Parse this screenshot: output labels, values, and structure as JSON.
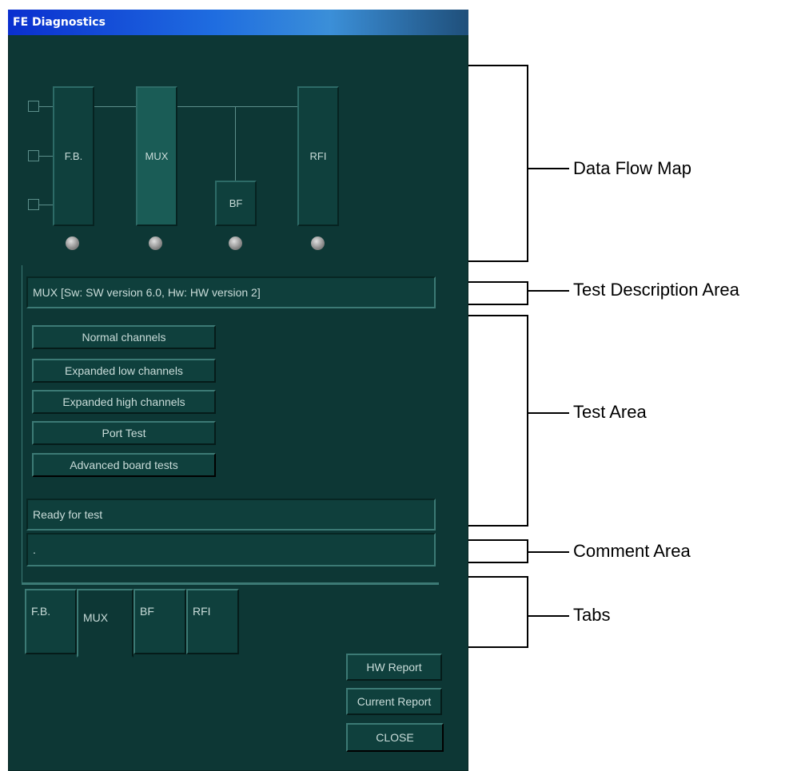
{
  "window": {
    "title": "FE Diagnostics"
  },
  "flow_map": {
    "blocks": [
      {
        "id": "fb",
        "label": "F.B."
      },
      {
        "id": "mux",
        "label": "MUX",
        "active": true
      },
      {
        "id": "bf",
        "label": "BF"
      },
      {
        "id": "rfi",
        "label": "RFI"
      }
    ]
  },
  "test_description": "MUX [Sw: SW version 6.0, Hw: HW version 2]",
  "tests": [
    "Normal channels",
    "Expanded low channels",
    "Expanded high channels",
    "Port Test",
    "Advanced board tests"
  ],
  "status_text": "Ready for test",
  "comment_text": ".",
  "tabs": [
    {
      "label": "F.B."
    },
    {
      "label": "MUX",
      "selected": true
    },
    {
      "label": "BF"
    },
    {
      "label": "RFI"
    }
  ],
  "buttons": {
    "hw_report": "HW Report",
    "current_report": "Current Report",
    "close": "CLOSE"
  },
  "callouts": {
    "data_flow_map": "Data Flow Map",
    "test_description_area": "Test Description Area",
    "test_area": "Test Area",
    "comment_area": "Comment Area",
    "tabs": "Tabs"
  },
  "colors": {
    "window_bg": "#0d3735",
    "title_bar": "#0a2fcf",
    "text": "#c9dcd9"
  }
}
